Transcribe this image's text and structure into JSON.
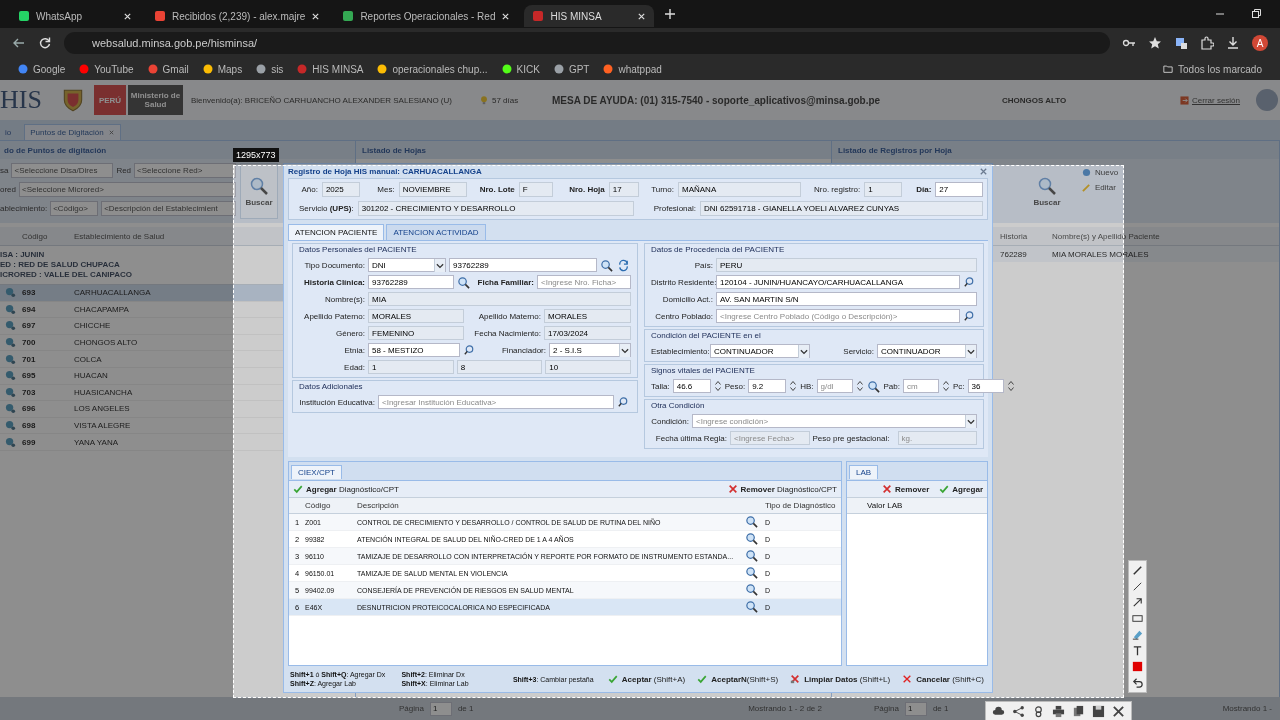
{
  "browser": {
    "tabs": [
      {
        "title": "WhatsApp",
        "color": "#25d366",
        "selected": false
      },
      {
        "title": "Recibidos (2,239) - alex.majre",
        "color": "#ea4335",
        "selected": false
      },
      {
        "title": "Reportes Operacionales - Red",
        "color": "#34a853",
        "selected": false
      },
      {
        "title": "HIS MINSA",
        "color": "#c62828",
        "selected": true
      }
    ],
    "url": "websalud.minsa.gob.pe/hisminsa/",
    "profile_initial": "A",
    "bookmarks": [
      {
        "label": "Google",
        "color": "#4285f4"
      },
      {
        "label": "YouTube",
        "color": "#ff0000"
      },
      {
        "label": "Gmail",
        "color": "#ea4335"
      },
      {
        "label": "Maps",
        "color": "#fbbc04"
      },
      {
        "label": "sis",
        "color": "#9aa0a6"
      },
      {
        "label": "HIS MINSA",
        "color": "#c62828"
      },
      {
        "label": "operacionales chup...",
        "color": "#fbbc04"
      },
      {
        "label": "KICK",
        "color": "#53fc18"
      },
      {
        "label": "GPT",
        "color": "#9aa0a6"
      },
      {
        "label": "whatppad",
        "color": "#ff6122"
      }
    ],
    "all_bookmarks": "Todos los marcado"
  },
  "header": {
    "logo": "HIS",
    "country": "PERÚ",
    "ministry": "Ministerio de Salud",
    "welcome": "Bienvenido(a): BRICEÑO CARHUANCHO ALEXANDER SALESIANO (U)",
    "days": "57 días",
    "helpdesk": "MESA DE AYUDA: (01) 315-7540 - soporte_aplicativos@minsa.gob.pe",
    "establishment": "CHONGOS ALTO",
    "logout": "Cerrar sesión"
  },
  "breadcrumb": [
    {
      "label": "io",
      "selected": false
    },
    {
      "label": "Puntos de Digitación",
      "selected": true
    }
  ],
  "points_panel": {
    "title": "do de Puntos de digitación",
    "filter_rows": [
      [
        {
          "label": "sa",
          "placeholder": "<Seleccione Disa/Dires"
        },
        {
          "label": "Red",
          "placeholder": "<Seleccione Red>"
        }
      ],
      [
        {
          "label": "ored",
          "placeholder": "<Seleccione Microred>"
        }
      ],
      [
        {
          "label": "ablecimiento:",
          "placeholder": "<Código>"
        },
        {
          "placeholder": "<Descripción del Establecimient"
        }
      ]
    ],
    "search": "Buscar",
    "columns": [
      "Código",
      "Establecimiento de Salud"
    ],
    "groups": [
      "ISA : JUNIN",
      "ED : RED DE SALUD CHUPACA",
      "ICRORED : VALLE DEL CANIPACO"
    ],
    "rows": [
      {
        "code": "693",
        "name": "CARHUACALLANGA",
        "selected": true
      },
      {
        "code": "694",
        "name": "CHACAPAMPA",
        "selected": false
      },
      {
        "code": "697",
        "name": "CHICCHE",
        "selected": false
      },
      {
        "code": "700",
        "name": "CHONGOS ALTO",
        "selected": false
      },
      {
        "code": "701",
        "name": "COLCA",
        "selected": false
      },
      {
        "code": "695",
        "name": "HUACAN",
        "selected": false
      },
      {
        "code": "703",
        "name": "HUASICANCHA",
        "selected": false
      },
      {
        "code": "696",
        "name": "LOS ANGELES",
        "selected": false
      },
      {
        "code": "698",
        "name": "VISTA ALEGRE",
        "selected": false
      },
      {
        "code": "699",
        "name": "YANA YANA",
        "selected": false
      }
    ]
  },
  "sheets_panel": {
    "title": "Listado de Hojas"
  },
  "records_panel": {
    "title": "Listado de Registros por Hoja",
    "search": "Buscar",
    "new": "Nuevo",
    "edit": "Editar",
    "columns": [
      "Historia",
      "Nombre(s) y Apellido Paciente"
    ],
    "rows": [
      {
        "history": "762289",
        "name": "MIA MORALES MORALES"
      }
    ]
  },
  "pagers": [
    {
      "page_label": "Página",
      "page": "1",
      "of": "de 1",
      "summary": "Mostrando 1 - 2 de 2"
    },
    {
      "page_label": "Página",
      "page": "1",
      "of": "de 1",
      "summary": "Mostrando 1 -"
    }
  ],
  "modal": {
    "title": "Registro de Hoja HIS manual: CARHUACALLANGA",
    "head": [
      {
        "label": "Año:",
        "value": "2025",
        "readonly": true
      },
      {
        "label": "Mes:",
        "value": "NOVIEMBRE",
        "readonly": true
      },
      {
        "label": "Nro. Lote",
        "value": "F",
        "strong": true,
        "readonly": true
      },
      {
        "label": "Nro. Hoja",
        "value": "17",
        "strong": true,
        "readonly": true
      },
      {
        "label": "Turno:",
        "value": "MAÑANA",
        "readonly": true
      },
      {
        "label": "Nro. registro:",
        "value": "1",
        "readonly": true
      },
      {
        "label": "Día:",
        "value": "27",
        "strong": true,
        "readonly": false
      }
    ],
    "service": {
      "label": "Servicio **(UPS)**:",
      "value": "301202 - CRECIMIENTO Y DESARROLLO",
      "readonly": true
    },
    "professional": {
      "label": "Profesional:",
      "value": "DNI 62591718 - GIANELLA YOELI ALVAREZ CUNYAS",
      "readonly": true
    },
    "tabs": [
      {
        "label": "ATENCION PACIENTE",
        "selected": true
      },
      {
        "label": "ATENCION ACTIVIDAD",
        "selected": false
      }
    ],
    "personal": {
      "legend": "Datos Personales del PACIENTE",
      "doc": {
        "label": "Tipo Documento:",
        "type": "DNI",
        "number": "93762289"
      },
      "history": {
        "label": "Historia Clínica:",
        "value": "93762289",
        "strong": true
      },
      "family": {
        "label": "Ficha Familiar:",
        "placeholder": "<Ingrese Nro. Ficha>",
        "strong": true
      },
      "names": {
        "label": "Nombre(s):",
        "value": "MIA",
        "readonly": true
      },
      "paternal": {
        "label": "Apellido Paterno:",
        "value": "MORALES",
        "readonly": true
      },
      "maternal": {
        "label": "Apellido Materno:",
        "value": "MORALES",
        "readonly": true
      },
      "gender": {
        "label": "Género:",
        "value": "FEMENINO",
        "readonly": true
      },
      "birth": {
        "label": "Fecha Nacimiento:",
        "value": "17/03/2024",
        "readonly": true
      },
      "ethnicity": {
        "label": "Etnia:",
        "value": "58 - MESTIZO"
      },
      "financer": {
        "label": "Financiador:",
        "value": "2 - S.I.S"
      },
      "age": {
        "label": "Edad:",
        "values": [
          "1",
          "8",
          "10"
        ],
        "readonly": true
      }
    },
    "additional": {
      "legend": "Datos Adicionales",
      "institution": {
        "label": "Institución Educativa:",
        "placeholder": "<Ingresar Institución Educativa>"
      }
    },
    "origin": {
      "legend": "Datos de Procedencia del PACIENTE",
      "country": {
        "label": "País:",
        "value": "PERU",
        "readonly": true
      },
      "district": {
        "label": "Distrito Residente:",
        "value": "120104 - JUNIN/HUANCAYO/CARHUACALLANGA"
      },
      "address": {
        "label": "Domicilio Act.:",
        "value": "AV. SAN MARTIN S/N"
      },
      "town": {
        "label": "Centro Poblado:",
        "placeholder": "<Ingrese Centro Poblado (Código o Descripción)>"
      }
    },
    "condition": {
      "legend": "Condición del PACIENTE en el",
      "establishment": {
        "label": "Establecimiento:",
        "value": "CONTINUADOR"
      },
      "service": {
        "label": "Servicio:",
        "value": "CONTINUADOR"
      }
    },
    "vitals": {
      "legend": "Signos vitales del PACIENTE",
      "items": [
        {
          "label": "Talla:",
          "value": "46.6"
        },
        {
          "label": "Peso:",
          "value": "9.2"
        },
        {
          "label": "HB:",
          "placeholder": "g/dl",
          "search": true
        },
        {
          "label": "Pab:",
          "placeholder": "cm"
        },
        {
          "label": "Pc:",
          "value": "36"
        }
      ]
    },
    "other": {
      "legend": "Otra Condición",
      "condition": {
        "label": "Condición:",
        "placeholder": "<Ingrese condición>"
      },
      "last_period": {
        "label": "Fecha última Regla:",
        "placeholder": "<Ingrese Fecha>",
        "readonly": true
      },
      "weight": {
        "label": "Peso pre gestacional:",
        "placeholder": "kg.",
        "readonly": true
      }
    },
    "diagnoses": {
      "tab": "CIEX/CPT",
      "add": "**Agregar** Diagnóstico/CPT",
      "remove": "**Remover** Diagnóstico/CPT",
      "columns": [
        "Código",
        "Descripción",
        "Tipo de Diagnóstico"
      ],
      "rows": [
        {
          "num": "1",
          "code": "Z001",
          "description": "CONTROL DE CRECIMIENTO Y DESARROLLO / CONTROL DE SALUD DE RUTINA DEL NIÑO",
          "type": "D",
          "selected": false
        },
        {
          "num": "2",
          "code": "99382",
          "description": "ATENCIÓN INTEGRAL DE SALUD DEL NIÑO-CRED DE 1 A 4 AÑOS",
          "type": "D",
          "selected": false
        },
        {
          "num": "3",
          "code": "96110",
          "description": "TAMIZAJE DE DESARROLLO CON INTERPRETACIÓN Y REPORTE POR FORMATO DE INSTRUMENTO ESTANDA...",
          "type": "D",
          "selected": false
        },
        {
          "num": "4",
          "code": "96150.01",
          "description": "TAMIZAJE DE SALUD MENTAL EN VIOLENCIA",
          "type": "D",
          "selected": false
        },
        {
          "num": "5",
          "code": "99402.09",
          "description": "CONSEJERÍA DE PREVENCIÓN DE RIESGOS EN SALUD MENTAL",
          "type": "D",
          "selected": false
        },
        {
          "num": "6",
          "code": "E46X",
          "description": "DESNUTRICION PROTEICOCALORICA NO ESPECIFICADA",
          "type": "D",
          "selected": true
        }
      ]
    },
    "lab": {
      "tab": "LAB",
      "remove": "Remover",
      "add": "Agregar",
      "columns": [
        "Valor LAB"
      ]
    },
    "shortcuts": [
      [
        "**Shift+1** ó **Shift+Q**: Agregar Dx",
        "**Shift+Z**: Agregar Lab"
      ],
      [
        "**Shift+2**: Eliminar Dx",
        "**Shift+X**: Eliminar Lab"
      ],
      [
        "**Shift+3**: Cambiar pestaña"
      ]
    ],
    "actions": [
      {
        "label": "**Aceptar** (Shift+A)",
        "kind": "accept"
      },
      {
        "label": "**AceptarN**(Shift+S)",
        "kind": "accept"
      },
      {
        "label": "**Limpiar Datos** (Shift+L)",
        "kind": "clear"
      },
      {
        "label": "**Cancelar** (Shift+C)",
        "kind": "cancel"
      }
    ]
  },
  "capture": {
    "size": "1295x773",
    "color": "#e00000"
  }
}
